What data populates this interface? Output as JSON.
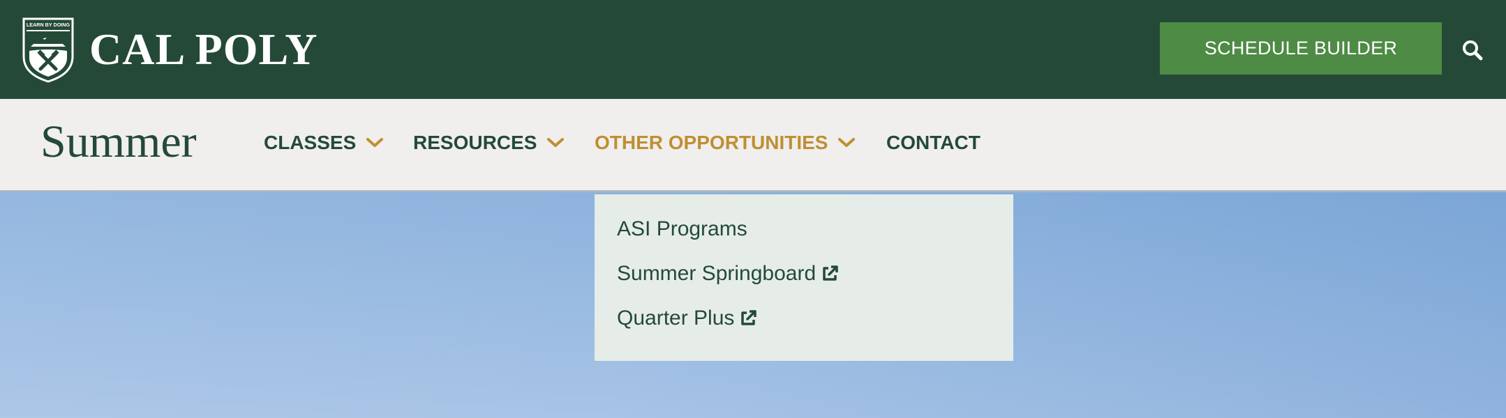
{
  "header": {
    "logo": {
      "seal_icon": "cal-poly-seal-icon",
      "seal_text": "LEARN BY DOING",
      "wordmark": "CAL POLY"
    },
    "schedule_button_label": "SCHEDULE BUILDER",
    "search_icon": "search-icon"
  },
  "nav": {
    "site_title": "Summer",
    "items": [
      {
        "label": "CLASSES",
        "has_dropdown": true,
        "active": false
      },
      {
        "label": "RESOURCES",
        "has_dropdown": true,
        "active": false
      },
      {
        "label": "OTHER OPPORTUNITIES",
        "has_dropdown": true,
        "active": true
      },
      {
        "label": "CONTACT",
        "has_dropdown": false,
        "active": false
      }
    ]
  },
  "dropdown": {
    "items": [
      {
        "label": "ASI Programs",
        "external": false
      },
      {
        "label": "Summer Springboard",
        "external": true,
        "icon": "external-link-icon"
      },
      {
        "label": "Quarter Plus",
        "external": true,
        "icon": "external-link-icon"
      }
    ]
  },
  "colors": {
    "header_bg": "#244a37",
    "button_bg": "#4e8b45",
    "nav_bg": "#f0efee",
    "nav_text": "#244a37",
    "nav_active": "#bf8f32",
    "dropdown_bg": "#e6ede8",
    "sky": "#8eb3de"
  }
}
